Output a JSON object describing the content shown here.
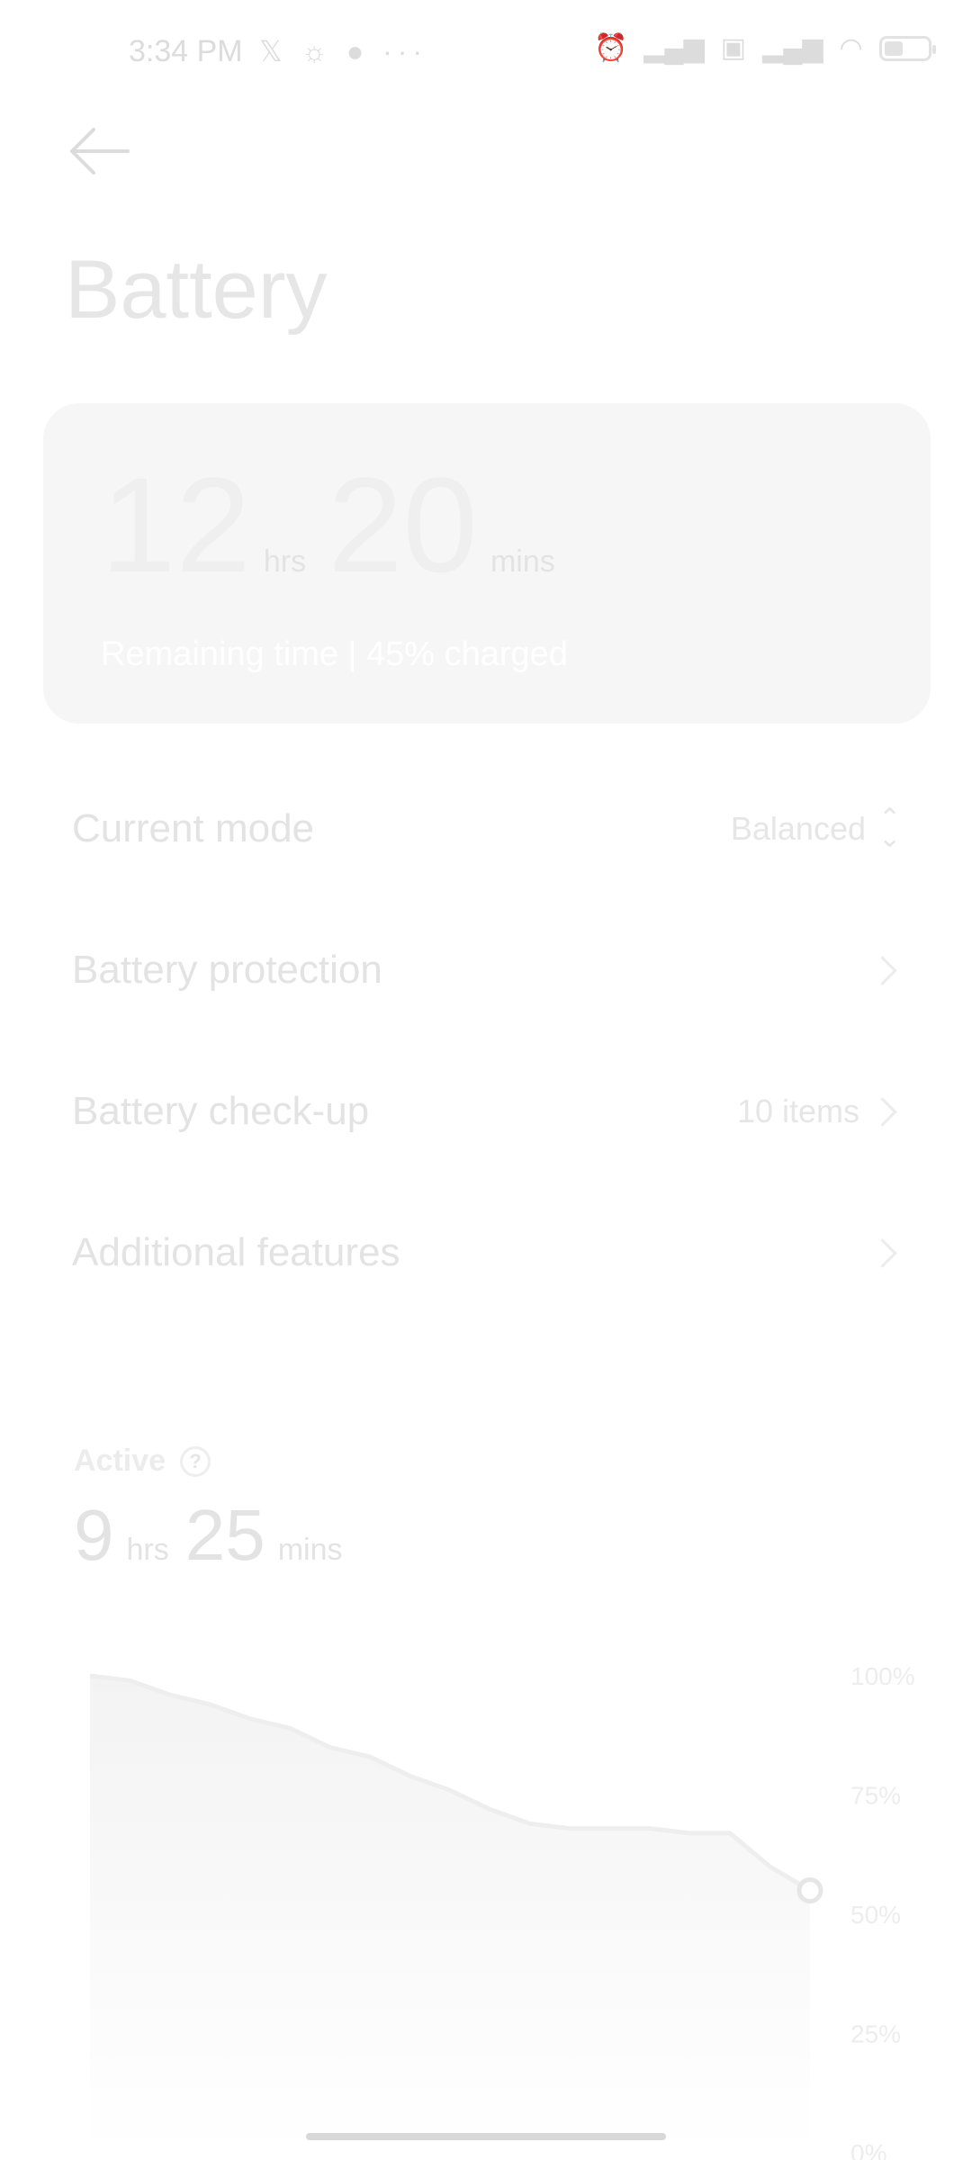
{
  "status_bar": {
    "time": "3:34 PM",
    "left_icons": [
      "x-icon",
      "sunrise-icon",
      "chat-icon",
      "more-icon"
    ],
    "right_icons": [
      "alarm-icon",
      "signal-icon",
      "volte-icon",
      "signal-icon",
      "wifi-icon",
      "battery-icon"
    ],
    "battery_level": 0.45
  },
  "header": {
    "title": "Battery"
  },
  "remaining": {
    "hours": "12",
    "hours_unit": "hrs",
    "minutes": "20",
    "minutes_unit": "mins",
    "subtitle": "Remaining time | 45% charged"
  },
  "rows": [
    {
      "label": "Current mode",
      "value": "Balanced",
      "icon": "up-down-icon"
    },
    {
      "label": "Battery protection",
      "value": "",
      "icon": "chevron-right-icon"
    },
    {
      "label": "Battery check-up",
      "value": "10 items",
      "icon": "chevron-right-icon"
    },
    {
      "label": "Additional features",
      "value": "",
      "icon": "chevron-right-icon"
    }
  ],
  "active": {
    "label": "Active",
    "hours": "9",
    "hours_unit": "hrs",
    "minutes": "25",
    "minutes_unit": "mins"
  },
  "chart_data": {
    "type": "area",
    "y_ticks": [
      "100%",
      "75%",
      "50%",
      "25%",
      "0%"
    ],
    "ylim": [
      0,
      100
    ],
    "x": [
      0,
      1,
      2,
      3,
      4,
      5,
      6,
      7,
      8,
      9,
      10,
      11,
      12,
      13,
      14,
      15,
      16,
      17,
      18
    ],
    "values": [
      100,
      99,
      96,
      94,
      91,
      89,
      85,
      83,
      79,
      76,
      72,
      69,
      68,
      68,
      68,
      67,
      67,
      60,
      55
    ]
  },
  "colors": {
    "accent": "#e6e6e6",
    "line": "#eeeeee"
  }
}
